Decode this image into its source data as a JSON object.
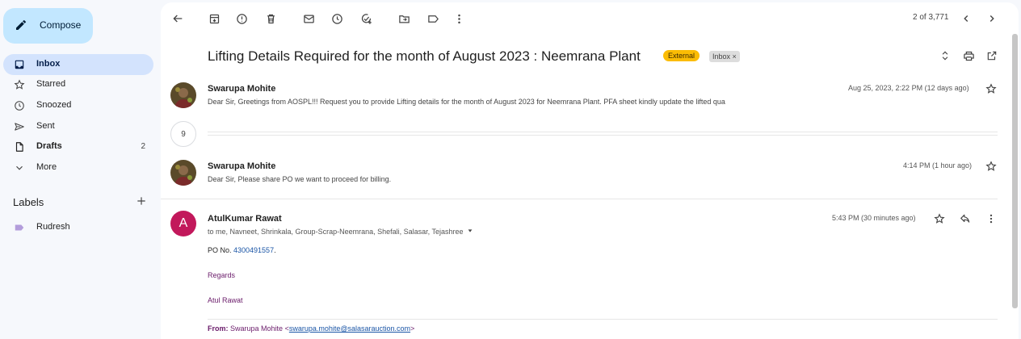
{
  "sidebar": {
    "compose_label": "Compose",
    "items": [
      {
        "label": "Inbox",
        "icon": "inbox-icon"
      },
      {
        "label": "Starred",
        "icon": "star-icon"
      },
      {
        "label": "Snoozed",
        "icon": "clock-icon"
      },
      {
        "label": "Sent",
        "icon": "send-icon"
      },
      {
        "label": "Drafts",
        "icon": "draft-icon",
        "count": "2"
      },
      {
        "label": "More",
        "icon": "chevron-down-icon"
      }
    ],
    "labels_header": "Labels",
    "labels": [
      {
        "label": "Rudresh",
        "color": "#b39ddb"
      }
    ]
  },
  "toolbar": {
    "pager_text": "2 of 3,771"
  },
  "thread": {
    "subject": "Lifting Details Required for the month of August 2023 : Neemrana Plant",
    "tag_external": "External",
    "tag_inbox": "Inbox",
    "tag_inbox_close": "×",
    "collapsed_count": "9",
    "messages": [
      {
        "sender": "Swarupa Mohite",
        "snippet": "Dear Sir, Greetings from AOSPL!!! Request you to provide Lifting details for the month of August 2023 for Neemrana Plant. PFA sheet kindly update the lifted qua",
        "time": "Aug 25, 2023, 2:22 PM (12 days ago)"
      },
      {
        "sender": "Swarupa Mohite",
        "snippet": "Dear Sir, Please share PO we want to proceed for billing.",
        "time": "4:14 PM (1 hour ago)"
      },
      {
        "sender": "AtulKumar Rawat",
        "avatar_letter": "A",
        "recipients": "to me, Navneet, Shrinkala, Group-Scrap-Neemrana, Shefali, Salasar, Tejashree",
        "time": "5:43 PM (30 minutes ago)",
        "po_prefix": "PO No. ",
        "po_number": "4300491557",
        "po_suffix": ".",
        "regards": "Regards",
        "signature": "Atul Rawat",
        "from_label": "From:",
        "from_name": "Swarupa Mohite",
        "from_email": "swarupa.mohite@salasarauction.com"
      }
    ]
  },
  "colors": {
    "accent": "#c2e7ff",
    "active_nav": "#d3e3fd",
    "external_tag": "#fbbc04",
    "avatar_a": "#c2185b"
  }
}
